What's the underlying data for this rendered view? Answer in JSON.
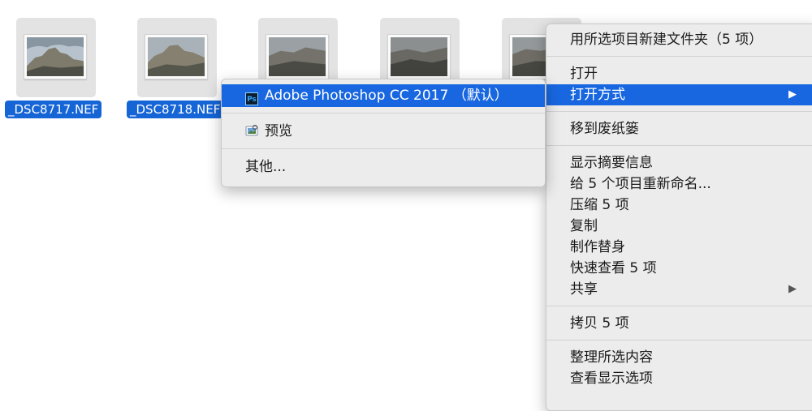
{
  "files": [
    {
      "name": "_DSC8717.NEF"
    },
    {
      "name": "_DSC8718.NEF"
    },
    {
      "name": ""
    },
    {
      "name": ""
    },
    {
      "name": ""
    }
  ],
  "context_menu": {
    "items": [
      {
        "label": "用所选项目新建文件夹（5 项）"
      },
      {
        "label": "打开"
      },
      {
        "label": "打开方式",
        "submenu_arrow": "▶"
      },
      {
        "label": "移到废纸篓"
      },
      {
        "label": "显示摘要信息"
      },
      {
        "label": "给 5 个项目重新命名..."
      },
      {
        "label": "压缩 5 项"
      },
      {
        "label": "复制"
      },
      {
        "label": "制作替身"
      },
      {
        "label": "快速查看 5 项"
      },
      {
        "label": "共享",
        "submenu_arrow": "▶"
      },
      {
        "label": "拷贝 5 项"
      },
      {
        "label": "整理所选内容"
      },
      {
        "label": "查看显示选项"
      }
    ]
  },
  "open_with_menu": {
    "items": [
      {
        "label": "Adobe Photoshop CC 2017 （默认）",
        "icon": "photoshop-icon",
        "icon_text": "Ps"
      },
      {
        "label": "预览",
        "icon": "preview-app-icon"
      },
      {
        "label": "其他..."
      }
    ]
  },
  "colors": {
    "selection": "#1867e0",
    "label_selection": "#1565d6",
    "menu_bg": "#ececec"
  }
}
